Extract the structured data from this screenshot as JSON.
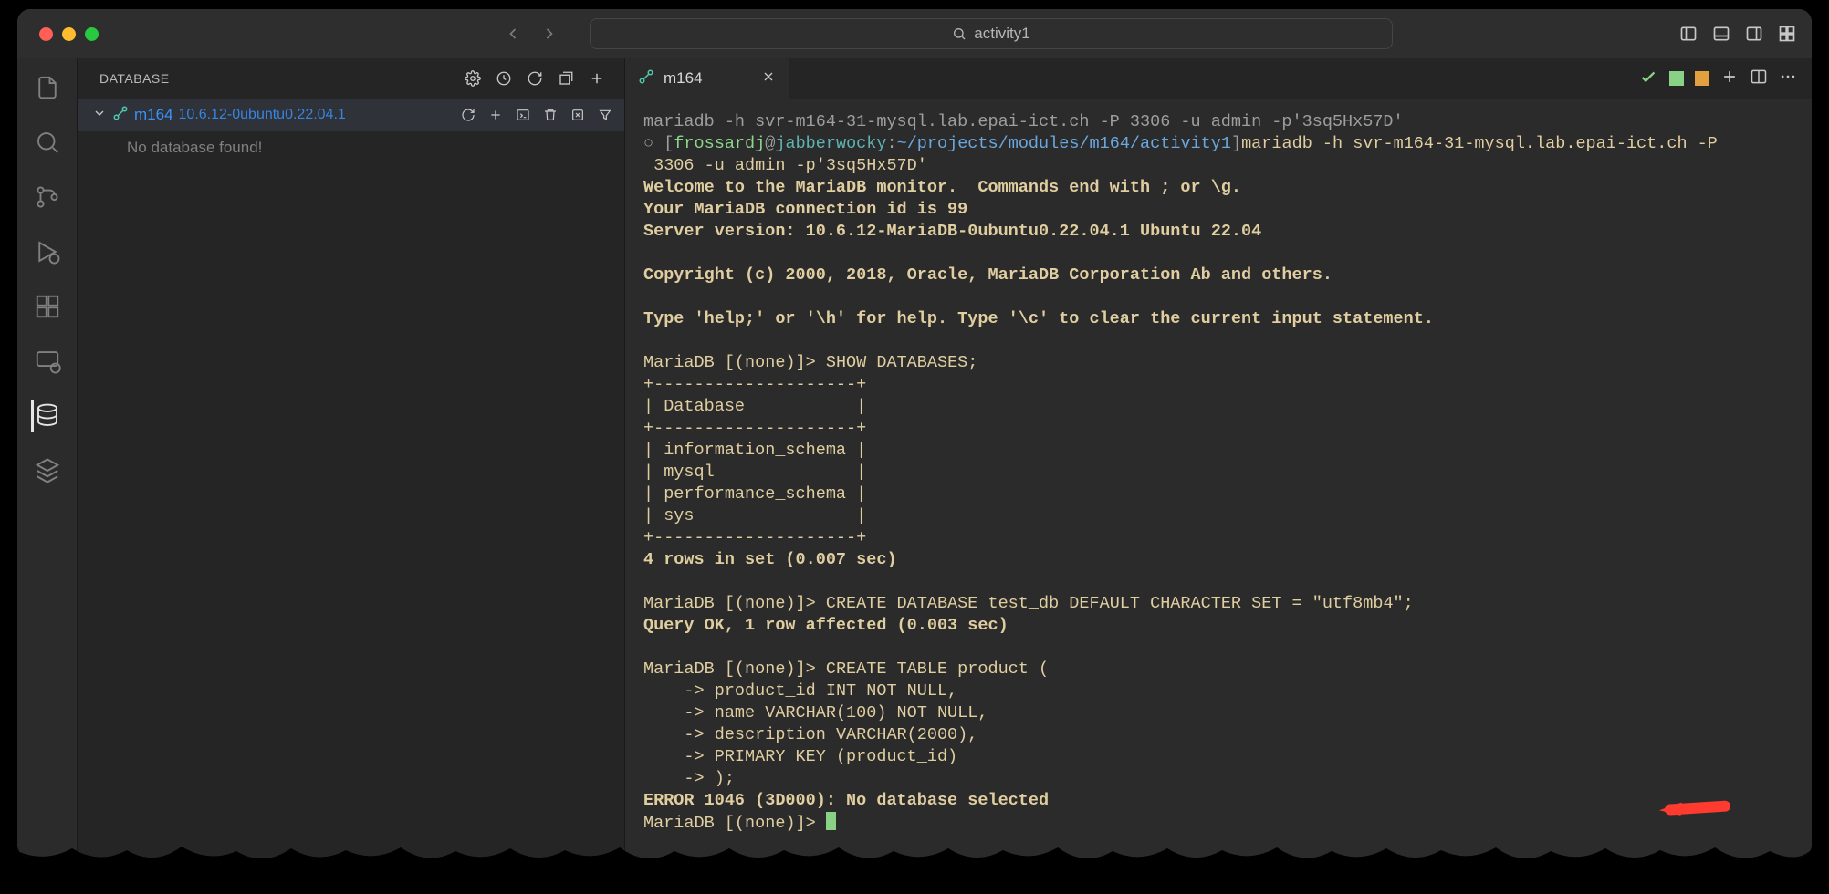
{
  "window": {
    "search_text": "activity1"
  },
  "sidebar": {
    "title": "DATABASE",
    "connection": {
      "name": "m164",
      "version": "10.6.12-0ubuntu0.22.04.1"
    },
    "no_db_text": "No database found!"
  },
  "tabs": {
    "active": {
      "label": "m164"
    }
  },
  "terminal": {
    "cmd_echoed": "mariadb -h svr-m164-31-mysql.lab.epai-ict.ch -P 3306 -u admin -p'3sq5Hx57D'",
    "prompt_user": "frossardj",
    "prompt_at": "@",
    "prompt_host": "jabberwocky",
    "prompt_sep": ":",
    "prompt_path": "~/projects/modules/m164/activity1",
    "prompt_cmd": "mariadb -h svr-m164-31-mysql.lab.epai-ict.ch -P",
    "prompt_cmd2": " 3306 -u admin -p'3sq5Hx57D'",
    "welcome1": "Welcome to the MariaDB monitor.  Commands end with ; or \\g.",
    "welcome2": "Your MariaDB connection id is 99",
    "welcome3": "Server version: 10.6.12-MariaDB-0ubuntu0.22.04.1 Ubuntu 22.04",
    "copyright": "Copyright (c) 2000, 2018, Oracle, MariaDB Corporation Ab and others.",
    "help": "Type 'help;' or '\\h' for help. Type '\\c' to clear the current input statement.",
    "p1": "MariaDB [(none)]> ",
    "s1": "SHOW DATABASES;",
    "sep": "+--------------------+",
    "hcol": "| Database           |",
    "r1": "| information_schema |",
    "r2": "| mysql              |",
    "r3": "| performance_schema |",
    "r4": "| sys                |",
    "rows": "4 rows in set (0.007 sec)",
    "s2": "CREATE DATABASE test_db DEFAULT CHARACTER SET = \"utf8mb4\";",
    "ok": "Query OK, 1 row affected (0.003 sec)",
    "s3": "CREATE TABLE product (",
    "c_arrow": "    -> ",
    "ct1": "product_id INT NOT NULL,",
    "ct2": "name VARCHAR(100) NOT NULL,",
    "ct3": "description VARCHAR(2000),",
    "ct4": "PRIMARY KEY (product_id)",
    "ct5": ");",
    "error": "ERROR 1046 (3D000): No database selected",
    "final_prompt": "MariaDB [(none)]> "
  }
}
